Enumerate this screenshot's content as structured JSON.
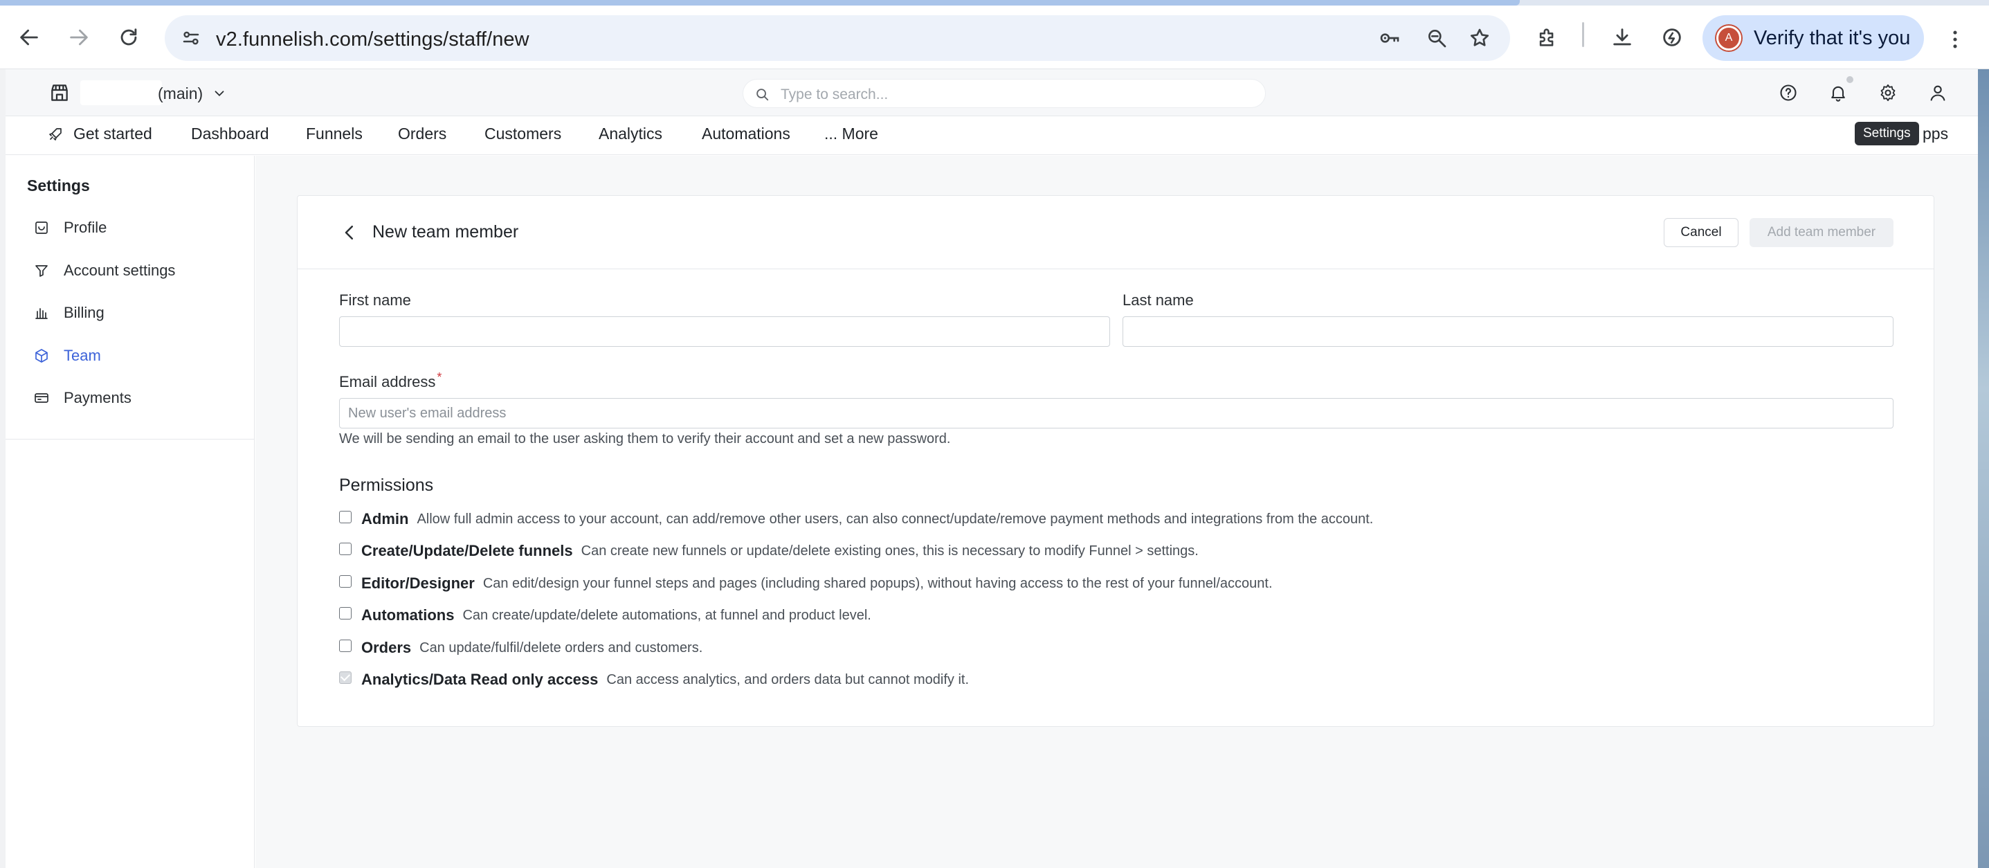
{
  "browser": {
    "url": "v2.funnelish.com/settings/staff/new",
    "verify_label": "Verify that it's you",
    "profile_initial": "A"
  },
  "header": {
    "store_name": "(main)",
    "search_placeholder": "Type to search..."
  },
  "nav": {
    "items": [
      {
        "label": "Get started"
      },
      {
        "label": "Dashboard"
      },
      {
        "label": "Funnels"
      },
      {
        "label": "Orders"
      },
      {
        "label": "Customers"
      },
      {
        "label": "Analytics"
      },
      {
        "label": "Automations"
      },
      {
        "label": "... More"
      }
    ],
    "apps_label": "pps",
    "tooltip": "Settings"
  },
  "sidebar": {
    "title": "Settings",
    "items": [
      {
        "label": "Profile",
        "icon": "profile-icon"
      },
      {
        "label": "Account settings",
        "icon": "filter-icon"
      },
      {
        "label": "Billing",
        "icon": "billing-icon"
      },
      {
        "label": "Team",
        "icon": "team-icon",
        "active": true
      },
      {
        "label": "Payments",
        "icon": "payments-icon"
      }
    ]
  },
  "form": {
    "title": "New team member",
    "cancel_label": "Cancel",
    "add_label": "Add team member",
    "first_name_label": "First name",
    "first_name_value": "",
    "last_name_label": "Last name",
    "last_name_value": "",
    "email_label": "Email address",
    "email_required_mark": "*",
    "email_placeholder": "New user's email address",
    "email_hint": "We will be sending an email to the user asking them to verify their account and set a new password.",
    "permissions_title": "Permissions",
    "permissions": [
      {
        "name": "Admin",
        "desc": "Allow full admin access to your account, can add/remove other users, can also connect/update/remove payment methods and integrations from the account.",
        "checked": false
      },
      {
        "name": "Create/Update/Delete funnels",
        "desc": "Can create new funnels or update/delete existing ones, this is necessary to modify Funnel > settings.",
        "checked": false
      },
      {
        "name": "Editor/Designer",
        "desc": "Can edit/design your funnel steps and pages (including shared popups), without having access to the rest of your funnel/account.",
        "checked": false
      },
      {
        "name": "Automations",
        "desc": "Can create/update/delete automations, at funnel and product level.",
        "checked": false
      },
      {
        "name": "Orders",
        "desc": "Can update/fulfil/delete orders and customers.",
        "checked": false
      },
      {
        "name": "Analytics/Data Read only access",
        "desc": "Can access analytics, and orders data but cannot modify it.",
        "checked": true
      }
    ]
  },
  "colors": {
    "accent": "#3d63d9",
    "required": "#d0393e",
    "verify_bg": "#d3e3fd"
  }
}
